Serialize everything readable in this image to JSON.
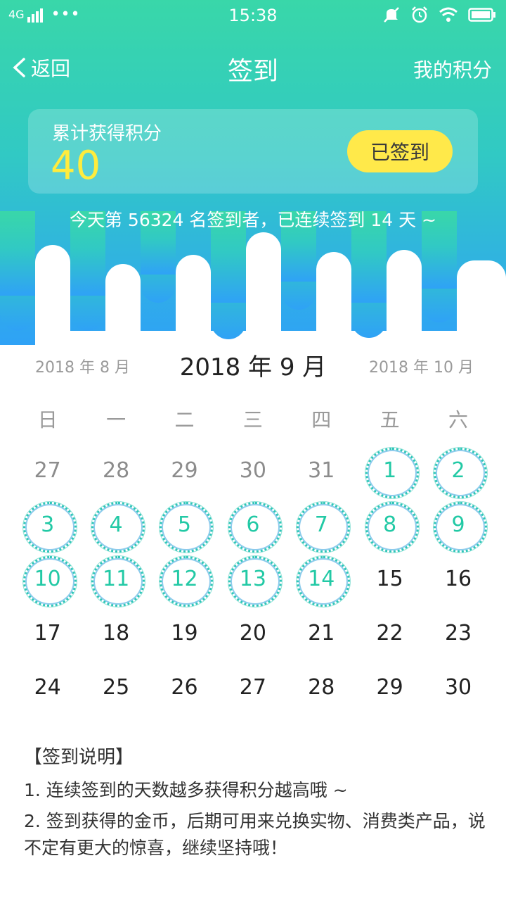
{
  "status_bar": {
    "network": "4G",
    "time": "15:38",
    "icons": [
      "signal-icon",
      "more-dots-icon",
      "mute-icon",
      "alarm-icon",
      "wifi-icon",
      "battery-icon"
    ]
  },
  "nav": {
    "back_label": "返回",
    "title": "签到",
    "my_points_label": "我的积分"
  },
  "points_card": {
    "label": "累计获得积分",
    "value": "40",
    "signed_button": "已签到"
  },
  "streak_text": "今天第 56324 名签到者，已连续签到 14 天 ~",
  "month_nav": {
    "prev": "2018 年 8 月",
    "current": "2018 年 9 月",
    "next": "2018 年 10 月"
  },
  "weekdays": [
    "日",
    "一",
    "二",
    "三",
    "四",
    "五",
    "六"
  ],
  "calendar": [
    [
      {
        "d": "27",
        "s": "other"
      },
      {
        "d": "28",
        "s": "other"
      },
      {
        "d": "29",
        "s": "other"
      },
      {
        "d": "30",
        "s": "other"
      },
      {
        "d": "31",
        "s": "other"
      },
      {
        "d": "1",
        "s": "signed"
      },
      {
        "d": "2",
        "s": "signed"
      }
    ],
    [
      {
        "d": "3",
        "s": "signed"
      },
      {
        "d": "4",
        "s": "signed"
      },
      {
        "d": "5",
        "s": "signed"
      },
      {
        "d": "6",
        "s": "signed"
      },
      {
        "d": "7",
        "s": "signed"
      },
      {
        "d": "8",
        "s": "signed"
      },
      {
        "d": "9",
        "s": "signed"
      }
    ],
    [
      {
        "d": "10",
        "s": "signed"
      },
      {
        "d": "11",
        "s": "signed"
      },
      {
        "d": "12",
        "s": "signed"
      },
      {
        "d": "13",
        "s": "signed"
      },
      {
        "d": "14",
        "s": "signed"
      },
      {
        "d": "15",
        "s": "normal"
      },
      {
        "d": "16",
        "s": "normal"
      }
    ],
    [
      {
        "d": "17",
        "s": "normal"
      },
      {
        "d": "18",
        "s": "normal"
      },
      {
        "d": "19",
        "s": "normal"
      },
      {
        "d": "20",
        "s": "normal"
      },
      {
        "d": "21",
        "s": "normal"
      },
      {
        "d": "22",
        "s": "normal"
      },
      {
        "d": "23",
        "s": "normal"
      }
    ],
    [
      {
        "d": "24",
        "s": "normal"
      },
      {
        "d": "25",
        "s": "normal"
      },
      {
        "d": "26",
        "s": "normal"
      },
      {
        "d": "27",
        "s": "normal"
      },
      {
        "d": "28",
        "s": "normal"
      },
      {
        "d": "29",
        "s": "normal"
      },
      {
        "d": "30",
        "s": "normal"
      }
    ]
  ],
  "rules": {
    "title": "【签到说明】",
    "items": [
      "1. 连续签到的天数越多获得积分越高哦 ~",
      "2. 签到获得的金币，后期可用来兑换实物、消费类产品，说不定有更大的惊喜，继续坚持哦！"
    ]
  },
  "colors": {
    "header_top": "#3ad8a8",
    "header_bottom": "#2ea4f4",
    "accent_yellow": "#ffe94a",
    "signed_green": "#22c9a5"
  }
}
